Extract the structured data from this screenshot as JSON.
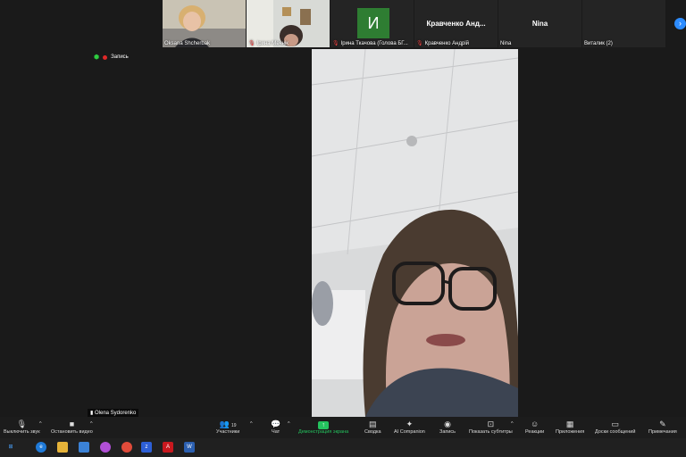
{
  "participants_strip": {
    "tiles": [
      {
        "name": "Oksana Shcherbak"
      },
      {
        "name": "Ірина Мечнік"
      },
      {
        "name": "Ірина Ткачова (Голова БГ...",
        "initial": "И"
      },
      {
        "name": "Кравченко Андрій",
        "display": "Кравченко Анд..."
      },
      {
        "name": "Nina",
        "display": "Nina"
      },
      {
        "name": "Виталик (2)"
      }
    ],
    "next_icon": "chevron-right-icon"
  },
  "recording": {
    "label": "Запись"
  },
  "active_speaker": {
    "name": "Olena Sydorenko"
  },
  "toolbar": {
    "mute": "Выключить звук",
    "video": "Остановить видео",
    "participants": "Участники",
    "participants_count": "19",
    "chat": "Чат",
    "share": "Демонстрация экрана",
    "summary": "Сводка",
    "companion": "AI Companion",
    "record": "Запись",
    "captions": "Показать субтитры",
    "reactions": "Реакции",
    "apps": "Приложения",
    "whiteboards": "Доски сообщений",
    "notes": "Примечания"
  },
  "taskbar": {
    "items": [
      "windows-start",
      "edge-browser",
      "file-explorer",
      "store",
      "copilot",
      "chrome",
      "zoom",
      "acrobat",
      "word"
    ]
  },
  "colors": {
    "share_green": "#24c35e",
    "record_red": "#e02828",
    "accent_blue": "#2d8cff"
  }
}
